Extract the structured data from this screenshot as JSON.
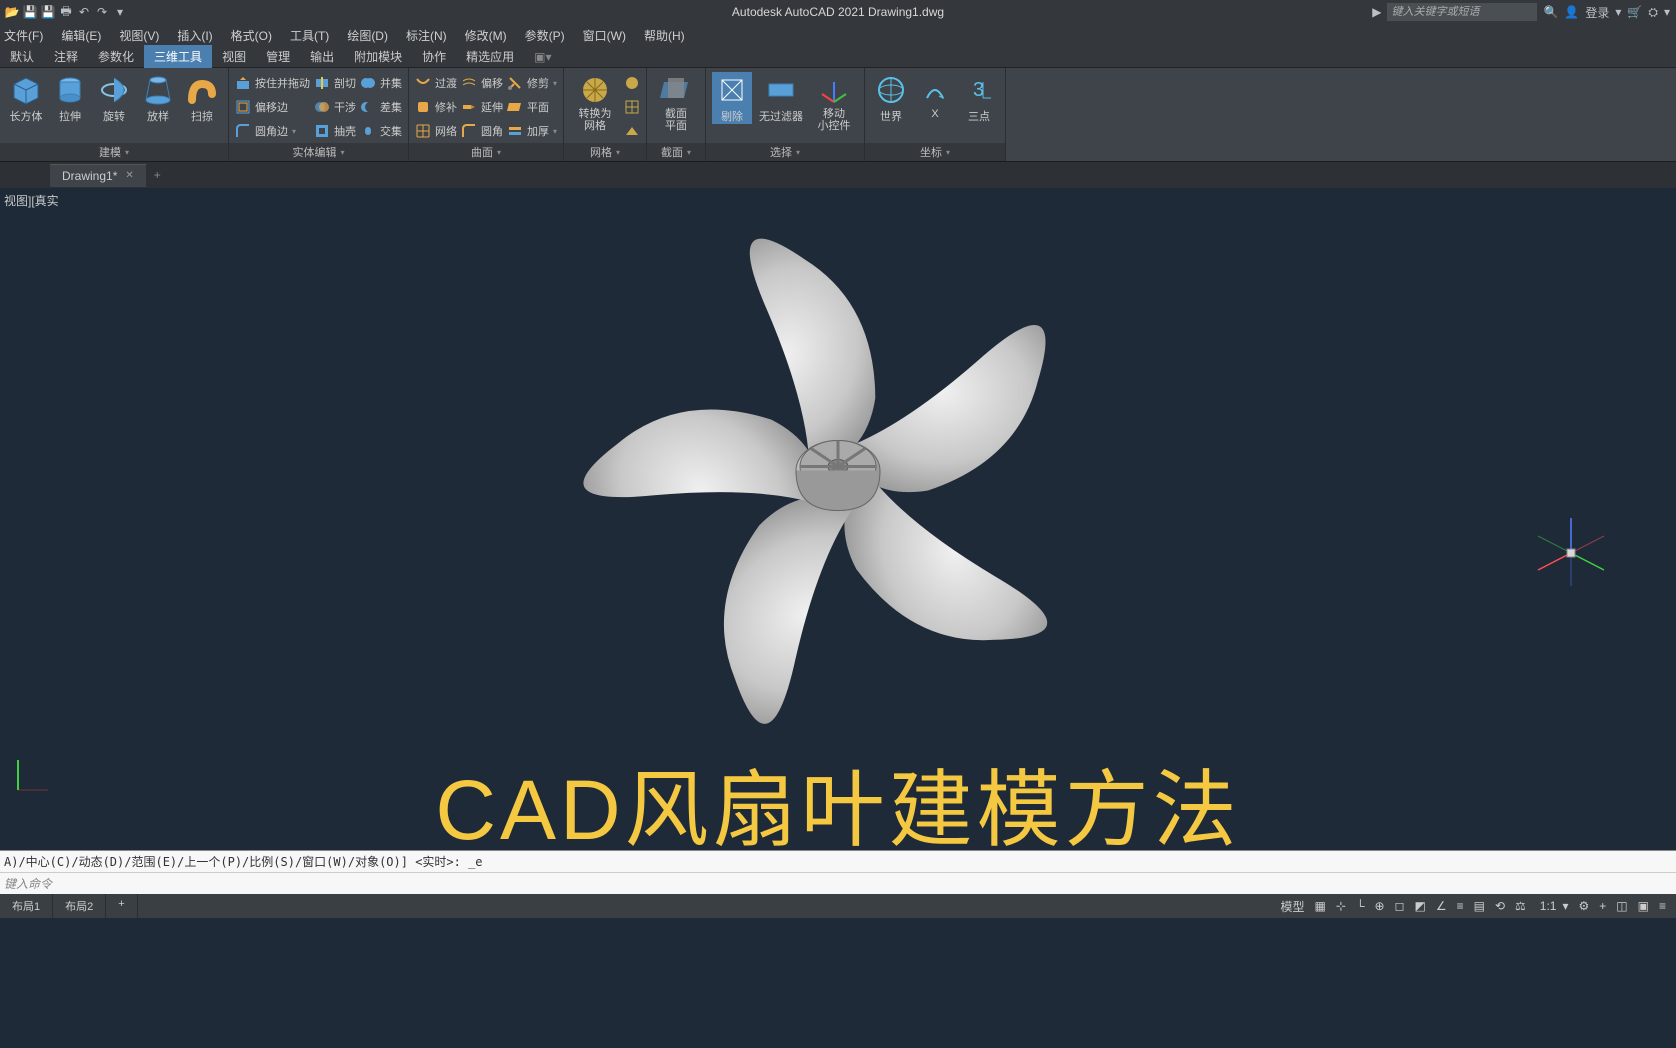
{
  "app": {
    "title": "Autodesk AutoCAD 2021   Drawing1.dwg",
    "search_placeholder": "键入关键字或短语",
    "login": "登录"
  },
  "menu": [
    "文件(F)",
    "编辑(E)",
    "视图(V)",
    "插入(I)",
    "格式(O)",
    "工具(T)",
    "绘图(D)",
    "标注(N)",
    "修改(M)",
    "参数(P)",
    "窗口(W)",
    "帮助(H)"
  ],
  "ribbon_tabs": [
    "默认",
    "注释",
    "参数化",
    "三维工具",
    "视图",
    "管理",
    "输出",
    "附加模块",
    "协作",
    "精选应用"
  ],
  "ribbon_active": "三维工具",
  "panels": {
    "model": {
      "title": "建模",
      "btns": [
        "长方体",
        "拉伸",
        "旋转",
        "放样",
        "扫掠"
      ]
    },
    "solid_edit": {
      "title": "实体编辑",
      "rows": [
        [
          "按住并拖动",
          "剖切",
          "并集"
        ],
        [
          "偏移边",
          "干涉",
          "差集"
        ],
        [
          "圆角边",
          "抽壳",
          "交集"
        ]
      ]
    },
    "curve": {
      "title": "曲面",
      "rows": [
        [
          "过渡",
          "偏移",
          "修剪"
        ],
        [
          "修补",
          "延伸",
          "平面"
        ],
        [
          "网络",
          "圆角",
          "加厚"
        ]
      ]
    },
    "mesh": {
      "title": "网格",
      "btn": "转换为\n网格"
    },
    "section": {
      "title": "截面",
      "btn": "截面\n平面"
    },
    "select": {
      "title": "选择",
      "btns": [
        "剔除",
        "无过滤器",
        "移动\n小控件"
      ]
    },
    "coord": {
      "title": "坐标",
      "btns": [
        "世界",
        "X",
        "三点"
      ]
    }
  },
  "file_tab": "Drawing1*",
  "viewport_label": "视图][真实",
  "overlay": "CAD风扇叶建模方法",
  "command_history": "A)/中心(C)/动态(D)/范围(E)/上一个(P)/比例(S)/窗口(W)/对象(O)] <实时>: _e",
  "command_prompt": "键入命令",
  "layouts": [
    "布局1",
    "布局2"
  ],
  "status": {
    "model": "模型",
    "scale": "1:1"
  }
}
